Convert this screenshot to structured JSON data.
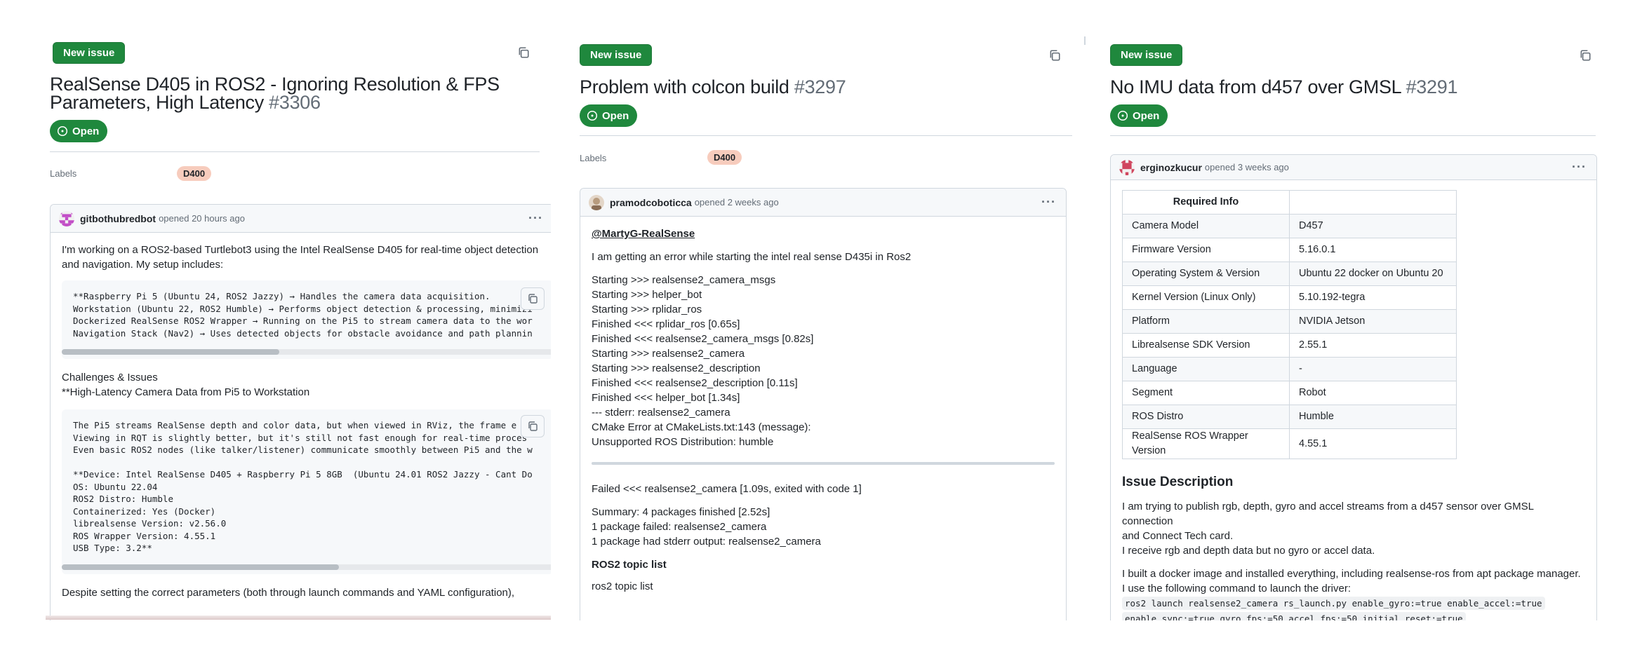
{
  "panel1": {
    "new_issue": "New issue",
    "title": "RealSense D405 in ROS2 - Ignoring Resolution & FPS Parameters, High Latency",
    "number": "#3306",
    "state": "Open",
    "labels_heading": "Labels",
    "label": "D400",
    "comment": {
      "author": "gitbothubredbot",
      "opened": "opened 20 hours ago",
      "intro": "I'm working on a ROS2-based Turtlebot3 using the Intel RealSense D405 for real-time object detection and navigation. My setup includes:",
      "code1": "**Raspberry Pi 5 (Ubuntu 24, ROS2 Jazzy) → Handles the camera data acquisition.\nWorkstation (Ubuntu 22, ROS2 Humble) → Performs object detection & processing, minimizi\nDockerized RealSense ROS2 Wrapper → Running on the Pi5 to stream camera data to the wor\nNavigation Stack (Nav2) → Uses detected objects for obstacle avoidance and path plannin",
      "challenges": "Challenges & Issues",
      "latency": "**High-Latency Camera Data from Pi5 to Workstation",
      "code2": "The Pi5 streams RealSense depth and color data, but when viewed in RViz, the frame e\nViewing in RQT is slightly better, but it's still not fast enough for real-time proces\nEven basic ROS2 nodes (like talker/listener) communicate smoothly between Pi5 and the w\n\n**Device: Intel RealSense D405 + Raspberry Pi 5 8GB  (Ubuntu 24.01 ROS2 Jazzy - Cant Do\nOS: Ubuntu 22.04\nROS2 Distro: Humble\nContainerized: Yes (Docker)\nlibrealsense Version: v2.56.0\nROS Wrapper Version: 4.55.1\nUSB Type: 3.2**",
      "outro": "Despite setting the correct parameters (both through launch commands and YAML configuration),"
    }
  },
  "panel2": {
    "new_issue": "New issue",
    "title": "Problem with colcon build",
    "number": "#3297",
    "state": "Open",
    "labels_heading": "Labels",
    "label": "D400",
    "comment": {
      "author": "pramodcoboticca",
      "opened": "opened 2 weeks ago",
      "mention": "@MartyG-RealSense",
      "intro": "I am getting an error while starting the intel real sense D435i in Ros2",
      "log_lines": [
        "Starting >>> realsense2_camera_msgs",
        "Starting >>> helper_bot",
        "Starting >>> rplidar_ros",
        "Finished <<< rplidar_ros [0.65s]",
        "Finished <<< realsense2_camera_msgs [0.82s]",
        "Starting >>> realsense2_camera",
        "Starting >>> realsense2_description",
        "Finished <<< realsense2_description [0.11s]",
        "Finished <<< helper_bot [1.34s]",
        "--- stderr: realsense2_camera",
        "CMake Error at CMakeLists.txt:143 (message):",
        "Unsupported ROS Distribution: humble"
      ],
      "failed": "Failed <<< realsense2_camera [1.09s, exited with code 1]",
      "summary_lines": [
        "Summary: 4 packages finished [2.52s]",
        "1 package failed: realsense2_camera",
        "1 package had stderr output: realsense2_camera"
      ],
      "topic_heading": "ROS2 topic list",
      "topic_text": "ros2 topic list"
    }
  },
  "panel3": {
    "new_issue": "New issue",
    "title": "No IMU data from d457 over GMSL",
    "number": "#3291",
    "state": "Open",
    "comment": {
      "author": "erginozkucur",
      "opened": "opened 3 weeks ago",
      "table_header": [
        "Required Info",
        ""
      ],
      "table_rows": [
        [
          "Camera Model",
          "D457"
        ],
        [
          "Firmware Version",
          "5.16.0.1"
        ],
        [
          "Operating System & Version",
          "Ubuntu 22 docker on Ubuntu 20"
        ],
        [
          "Kernel Version (Linux Only)",
          "5.10.192-tegra"
        ],
        [
          "Platform",
          "NVIDIA Jetson"
        ],
        [
          "Librealsense SDK Version",
          "2.55.1"
        ],
        [
          "Language",
          "-"
        ],
        [
          "Segment",
          "Robot"
        ],
        [
          "ROS Distro",
          "Humble"
        ],
        [
          "RealSense ROS Wrapper Version",
          "4.55.1"
        ]
      ],
      "section_heading": "Issue Description",
      "desc1_line1": "I am trying to publish rgb, depth, gyro and accel streams from a d457 sensor over GMSL connection",
      "desc1_line2": "and Connect Tech card.",
      "desc1_line3": "I receive rgb and depth data but no gyro or accel data.",
      "desc2_line1": "I built a docker image and installed everything, including realsense-ros from apt package manager.",
      "desc2_line2": "I use the following command to launch the driver:",
      "cmd_line1": "ros2 launch realsense2_camera rs_launch.py enable_gyro:=true enable_accel:=true",
      "cmd_line2": "enable_sync:=true gyro_fps:=50 accel_fps:=50 initial_reset:=true"
    }
  },
  "colors": {
    "green": "#1f883d",
    "label_bg": "#f7ccbd",
    "border": "#d0d7de",
    "muted": "#636c76"
  },
  "icons": [
    "copy-icon",
    "issue-open-icon",
    "kebab-menu-icon",
    "avatar"
  ]
}
